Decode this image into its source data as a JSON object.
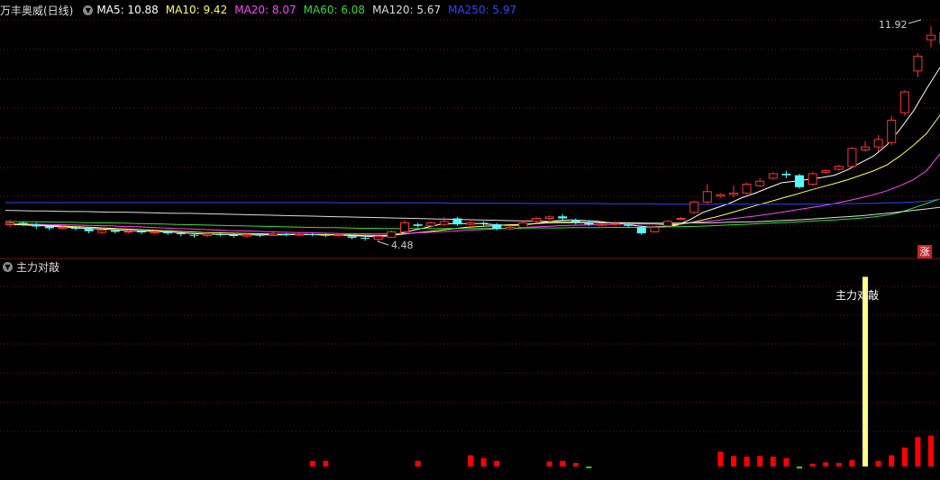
{
  "header": {
    "title": "万丰奥威(日线)",
    "ma": [
      {
        "label": "MA5: 10.88",
        "color": "#ffffff"
      },
      {
        "label": "MA10: 9.42",
        "color": "#ffff55"
      },
      {
        "label": "MA20: 8.07",
        "color": "#ff44ff"
      },
      {
        "label": "MA60: 6.08",
        "color": "#33dd33"
      },
      {
        "label": "MA120: 5.67",
        "color": "#dddddd"
      },
      {
        "label": "MA250: 5.97",
        "color": "#3344ff"
      }
    ]
  },
  "indicator": {
    "name": "主力对敲",
    "peak_label": "主力对敲"
  },
  "annotations": {
    "high": "11.92",
    "low": "4.48",
    "badge": "涨"
  },
  "colors": {
    "up": "#ff3333",
    "down": "#54fcfc",
    "bar": "#ff0000",
    "highlight": "#ffff88",
    "grid": "#7a1010"
  },
  "chart_data": {
    "type": "candlestick",
    "title": "万丰奥威(日线)",
    "price_high": 11.92,
    "price_low": 4.48,
    "candles": [
      [
        5.05,
        5.1,
        4.95,
        5.2
      ],
      [
        5.1,
        5.05,
        5.0,
        5.15
      ],
      [
        5.05,
        4.98,
        4.9,
        5.1
      ],
      [
        4.98,
        4.92,
        4.85,
        5.02
      ],
      [
        4.92,
        4.95,
        4.88,
        5.0
      ],
      [
        4.95,
        4.9,
        4.85,
        5.0
      ],
      [
        4.9,
        4.82,
        4.75,
        4.95
      ],
      [
        4.78,
        4.85,
        4.72,
        4.9
      ],
      [
        4.85,
        4.8,
        4.75,
        4.9
      ],
      [
        4.8,
        4.82,
        4.75,
        4.88
      ],
      [
        4.82,
        4.78,
        4.72,
        4.85
      ],
      [
        4.78,
        4.8,
        4.72,
        4.85
      ],
      [
        4.8,
        4.75,
        4.7,
        4.85
      ],
      [
        4.75,
        4.72,
        4.65,
        4.8
      ],
      [
        4.7,
        4.68,
        4.6,
        4.75
      ],
      [
        4.68,
        4.72,
        4.62,
        4.78
      ],
      [
        4.72,
        4.7,
        4.65,
        4.76
      ],
      [
        4.7,
        4.66,
        4.6,
        4.74
      ],
      [
        4.66,
        4.7,
        4.6,
        4.75
      ],
      [
        4.7,
        4.68,
        4.62,
        4.74
      ],
      [
        4.68,
        4.72,
        4.65,
        4.78
      ],
      [
        4.72,
        4.7,
        4.65,
        4.76
      ],
      [
        4.7,
        4.72,
        4.66,
        4.78
      ],
      [
        4.72,
        4.7,
        4.65,
        4.76
      ],
      [
        4.7,
        4.68,
        4.62,
        4.74
      ],
      [
        4.68,
        4.7,
        4.64,
        4.75
      ],
      [
        4.65,
        4.6,
        4.55,
        4.7
      ],
      [
        4.6,
        4.58,
        4.5,
        4.65
      ],
      [
        4.55,
        4.65,
        4.48,
        4.68
      ],
      [
        4.62,
        4.8,
        4.6,
        4.85
      ],
      [
        4.8,
        5.1,
        4.75,
        5.2
      ],
      [
        5.05,
        5.0,
        4.95,
        5.1
      ],
      [
        5.0,
        5.1,
        4.95,
        5.15
      ],
      [
        5.05,
        5.15,
        5.0,
        5.3
      ],
      [
        5.25,
        5.05,
        5.0,
        5.3
      ],
      [
        5.05,
        5.1,
        5.0,
        5.15
      ],
      [
        5.1,
        5.08,
        5.0,
        5.15
      ],
      [
        5.05,
        4.9,
        4.85,
        5.1
      ],
      [
        4.9,
        4.95,
        4.85,
        5.0
      ],
      [
        4.95,
        5.1,
        4.9,
        5.15
      ],
      [
        5.15,
        5.25,
        5.1,
        5.3
      ],
      [
        5.25,
        5.3,
        5.2,
        5.35
      ],
      [
        5.32,
        5.25,
        5.2,
        5.4
      ],
      [
        5.2,
        5.12,
        5.05,
        5.25
      ],
      [
        5.12,
        5.05,
        5.0,
        5.18
      ],
      [
        5.05,
        5.05,
        5.0,
        5.1
      ],
      [
        5.05,
        5.08,
        5.0,
        5.15
      ],
      [
        5.05,
        5.0,
        4.95,
        5.1
      ],
      [
        4.95,
        4.75,
        4.7,
        5.0
      ],
      [
        4.8,
        4.95,
        4.78,
        5.0
      ],
      [
        5.0,
        5.15,
        4.95,
        5.2
      ],
      [
        5.25,
        5.25,
        5.2,
        5.3
      ],
      [
        5.45,
        5.8,
        5.4,
        5.85
      ],
      [
        5.8,
        6.15,
        5.75,
        6.4
      ],
      [
        6.0,
        6.05,
        5.95,
        6.1
      ],
      [
        6.05,
        6.1,
        5.95,
        6.35
      ],
      [
        6.1,
        6.4,
        6.05,
        6.45
      ],
      [
        6.35,
        6.5,
        6.3,
        6.6
      ],
      [
        6.6,
        6.75,
        6.55,
        6.8
      ],
      [
        6.75,
        6.7,
        6.6,
        6.85
      ],
      [
        6.7,
        6.3,
        6.25,
        6.75
      ],
      [
        6.4,
        6.75,
        6.35,
        6.8
      ],
      [
        6.8,
        6.85,
        6.75,
        6.9
      ],
      [
        6.9,
        7.0,
        6.85,
        7.05
      ],
      [
        7.0,
        7.6,
        6.95,
        7.65
      ],
      [
        7.55,
        7.65,
        7.5,
        7.85
      ],
      [
        7.65,
        7.9,
        7.5,
        8.05
      ],
      [
        7.8,
        8.55,
        7.7,
        8.7
      ],
      [
        8.8,
        9.5,
        8.7,
        9.55
      ],
      [
        10.2,
        10.7,
        10.0,
        10.8
      ],
      [
        11.25,
        11.4,
        11.0,
        11.7
      ],
      [
        11.5,
        11.1,
        10.7,
        11.6
      ],
      [
        11.0,
        11.9,
        10.9,
        11.92
      ]
    ],
    "ma_series": [
      {
        "name": "MA5",
        "values": [
          5.05,
          5.04,
          5.02,
          5.0,
          4.97,
          4.95,
          4.92,
          4.9,
          4.88,
          4.85,
          4.83,
          4.82,
          4.8,
          4.78,
          4.75,
          4.73,
          4.72,
          4.71,
          4.7,
          4.7,
          4.7,
          4.7,
          4.71,
          4.71,
          4.7,
          4.7,
          4.68,
          4.66,
          4.64,
          4.66,
          4.75,
          4.85,
          4.95,
          5.05,
          5.08,
          5.08,
          5.08,
          5.05,
          5.02,
          5.02,
          5.06,
          5.12,
          5.18,
          5.2,
          5.18,
          5.15,
          5.1,
          5.07,
          5.0,
          4.96,
          4.98,
          5.02,
          5.2,
          5.45,
          5.6,
          5.75,
          5.95,
          6.1,
          6.28,
          6.45,
          6.5,
          6.56,
          6.62,
          6.7,
          6.88,
          7.12,
          7.35,
          7.72,
          8.25,
          8.85,
          9.6,
          10.3,
          10.88
        ]
      },
      {
        "name": "MA10",
        "values": [
          5.06,
          5.05,
          5.04,
          5.02,
          5.0,
          4.98,
          4.96,
          4.94,
          4.92,
          4.9,
          4.88,
          4.86,
          4.84,
          4.82,
          4.8,
          4.78,
          4.77,
          4.76,
          4.75,
          4.74,
          4.73,
          4.72,
          4.72,
          4.71,
          4.71,
          4.7,
          4.7,
          4.69,
          4.68,
          4.68,
          4.71,
          4.76,
          4.8,
          4.85,
          4.9,
          4.95,
          4.98,
          5.0,
          5.03,
          5.05,
          5.07,
          5.09,
          5.11,
          5.11,
          5.11,
          5.11,
          5.11,
          5.11,
          5.1,
          5.08,
          5.05,
          5.04,
          5.1,
          5.2,
          5.3,
          5.42,
          5.55,
          5.68,
          5.8,
          5.93,
          6.05,
          6.18,
          6.3,
          6.42,
          6.55,
          6.7,
          6.85,
          7.05,
          7.35,
          7.7,
          8.1,
          8.7,
          9.42
        ]
      },
      {
        "name": "MA20",
        "values": [
          5.08,
          5.07,
          5.06,
          5.05,
          5.04,
          5.03,
          5.02,
          5.01,
          5.0,
          4.98,
          4.97,
          4.95,
          4.93,
          4.91,
          4.9,
          4.88,
          4.86,
          4.84,
          4.83,
          4.82,
          4.8,
          4.79,
          4.78,
          4.77,
          4.76,
          4.75,
          4.74,
          4.74,
          4.73,
          4.73,
          4.74,
          4.76,
          4.78,
          4.8,
          4.82,
          4.85,
          4.87,
          4.89,
          4.91,
          4.93,
          4.96,
          4.98,
          5.0,
          5.02,
          5.03,
          5.04,
          5.05,
          5.06,
          5.06,
          5.06,
          5.07,
          5.07,
          5.1,
          5.14,
          5.18,
          5.23,
          5.28,
          5.33,
          5.39,
          5.46,
          5.53,
          5.6,
          5.67,
          5.75,
          5.84,
          5.94,
          6.05,
          6.18,
          6.35,
          6.55,
          6.85,
          7.4,
          8.07
        ]
      },
      {
        "name": "MA60",
        "values": [
          5.15,
          5.14,
          5.14,
          5.13,
          5.12,
          5.12,
          5.11,
          5.1,
          5.1,
          5.09,
          5.08,
          5.07,
          5.06,
          5.05,
          5.04,
          5.03,
          5.02,
          5.01,
          5.0,
          4.99,
          4.98,
          4.97,
          4.96,
          4.95,
          4.94,
          4.94,
          4.93,
          4.92,
          4.92,
          4.91,
          4.91,
          4.91,
          4.91,
          4.91,
          4.91,
          4.91,
          4.91,
          4.92,
          4.92,
          4.92,
          4.93,
          4.93,
          4.93,
          4.94,
          4.94,
          4.94,
          4.95,
          4.95,
          4.95,
          4.96,
          4.96,
          4.97,
          4.98,
          4.99,
          5.01,
          5.03,
          5.05,
          5.07,
          5.09,
          5.11,
          5.13,
          5.15,
          5.18,
          5.2,
          5.23,
          5.26,
          5.3,
          5.36,
          5.45,
          5.6,
          5.75,
          5.9,
          6.08
        ]
      },
      {
        "name": "MA120",
        "values": [
          5.52,
          5.51,
          5.5,
          5.5,
          5.49,
          5.48,
          5.48,
          5.47,
          5.46,
          5.46,
          5.45,
          5.44,
          5.43,
          5.42,
          5.42,
          5.41,
          5.4,
          5.39,
          5.38,
          5.37,
          5.36,
          5.35,
          5.34,
          5.33,
          5.32,
          5.31,
          5.3,
          5.29,
          5.28,
          5.27,
          5.26,
          5.25,
          5.24,
          5.23,
          5.22,
          5.21,
          5.2,
          5.19,
          5.18,
          5.17,
          5.16,
          5.15,
          5.14,
          5.13,
          5.12,
          5.11,
          5.1,
          5.1,
          5.09,
          5.09,
          5.09,
          5.09,
          5.1,
          5.1,
          5.11,
          5.12,
          5.13,
          5.14,
          5.16,
          5.18,
          5.2,
          5.22,
          5.25,
          5.28,
          5.31,
          5.34,
          5.38,
          5.42,
          5.47,
          5.52,
          5.57,
          5.62,
          5.67
        ]
      },
      {
        "name": "MA250",
        "values": [
          5.78,
          5.78,
          5.78,
          5.78,
          5.78,
          5.78,
          5.78,
          5.78,
          5.78,
          5.78,
          5.78,
          5.78,
          5.78,
          5.78,
          5.78,
          5.78,
          5.78,
          5.78,
          5.78,
          5.78,
          5.78,
          5.78,
          5.78,
          5.78,
          5.78,
          5.78,
          5.77,
          5.77,
          5.77,
          5.77,
          5.77,
          5.77,
          5.77,
          5.77,
          5.76,
          5.76,
          5.76,
          5.76,
          5.76,
          5.76,
          5.75,
          5.75,
          5.75,
          5.75,
          5.75,
          5.75,
          5.74,
          5.74,
          5.74,
          5.74,
          5.73,
          5.73,
          5.73,
          5.73,
          5.73,
          5.73,
          5.73,
          5.73,
          5.73,
          5.73,
          5.73,
          5.73,
          5.73,
          5.74,
          5.74,
          5.75,
          5.76,
          5.77,
          5.78,
          5.8,
          5.83,
          5.9,
          5.97
        ]
      }
    ],
    "indicator_values": [
      0,
      0,
      0,
      0,
      0,
      0,
      0,
      0,
      0,
      0,
      0,
      0,
      0,
      0,
      0,
      0,
      0,
      0,
      0,
      0,
      0,
      8,
      8,
      0,
      0,
      0,
      0,
      0,
      0,
      8,
      0,
      0,
      0,
      16,
      12,
      8,
      0,
      0,
      0,
      7,
      8,
      5,
      -1,
      0,
      0,
      0,
      0,
      0,
      0,
      0,
      0,
      0,
      21,
      15,
      14,
      15,
      14,
      12,
      -3,
      4,
      6,
      5,
      9,
      270,
      8,
      16,
      27,
      42,
      44,
      32,
      31
    ]
  }
}
